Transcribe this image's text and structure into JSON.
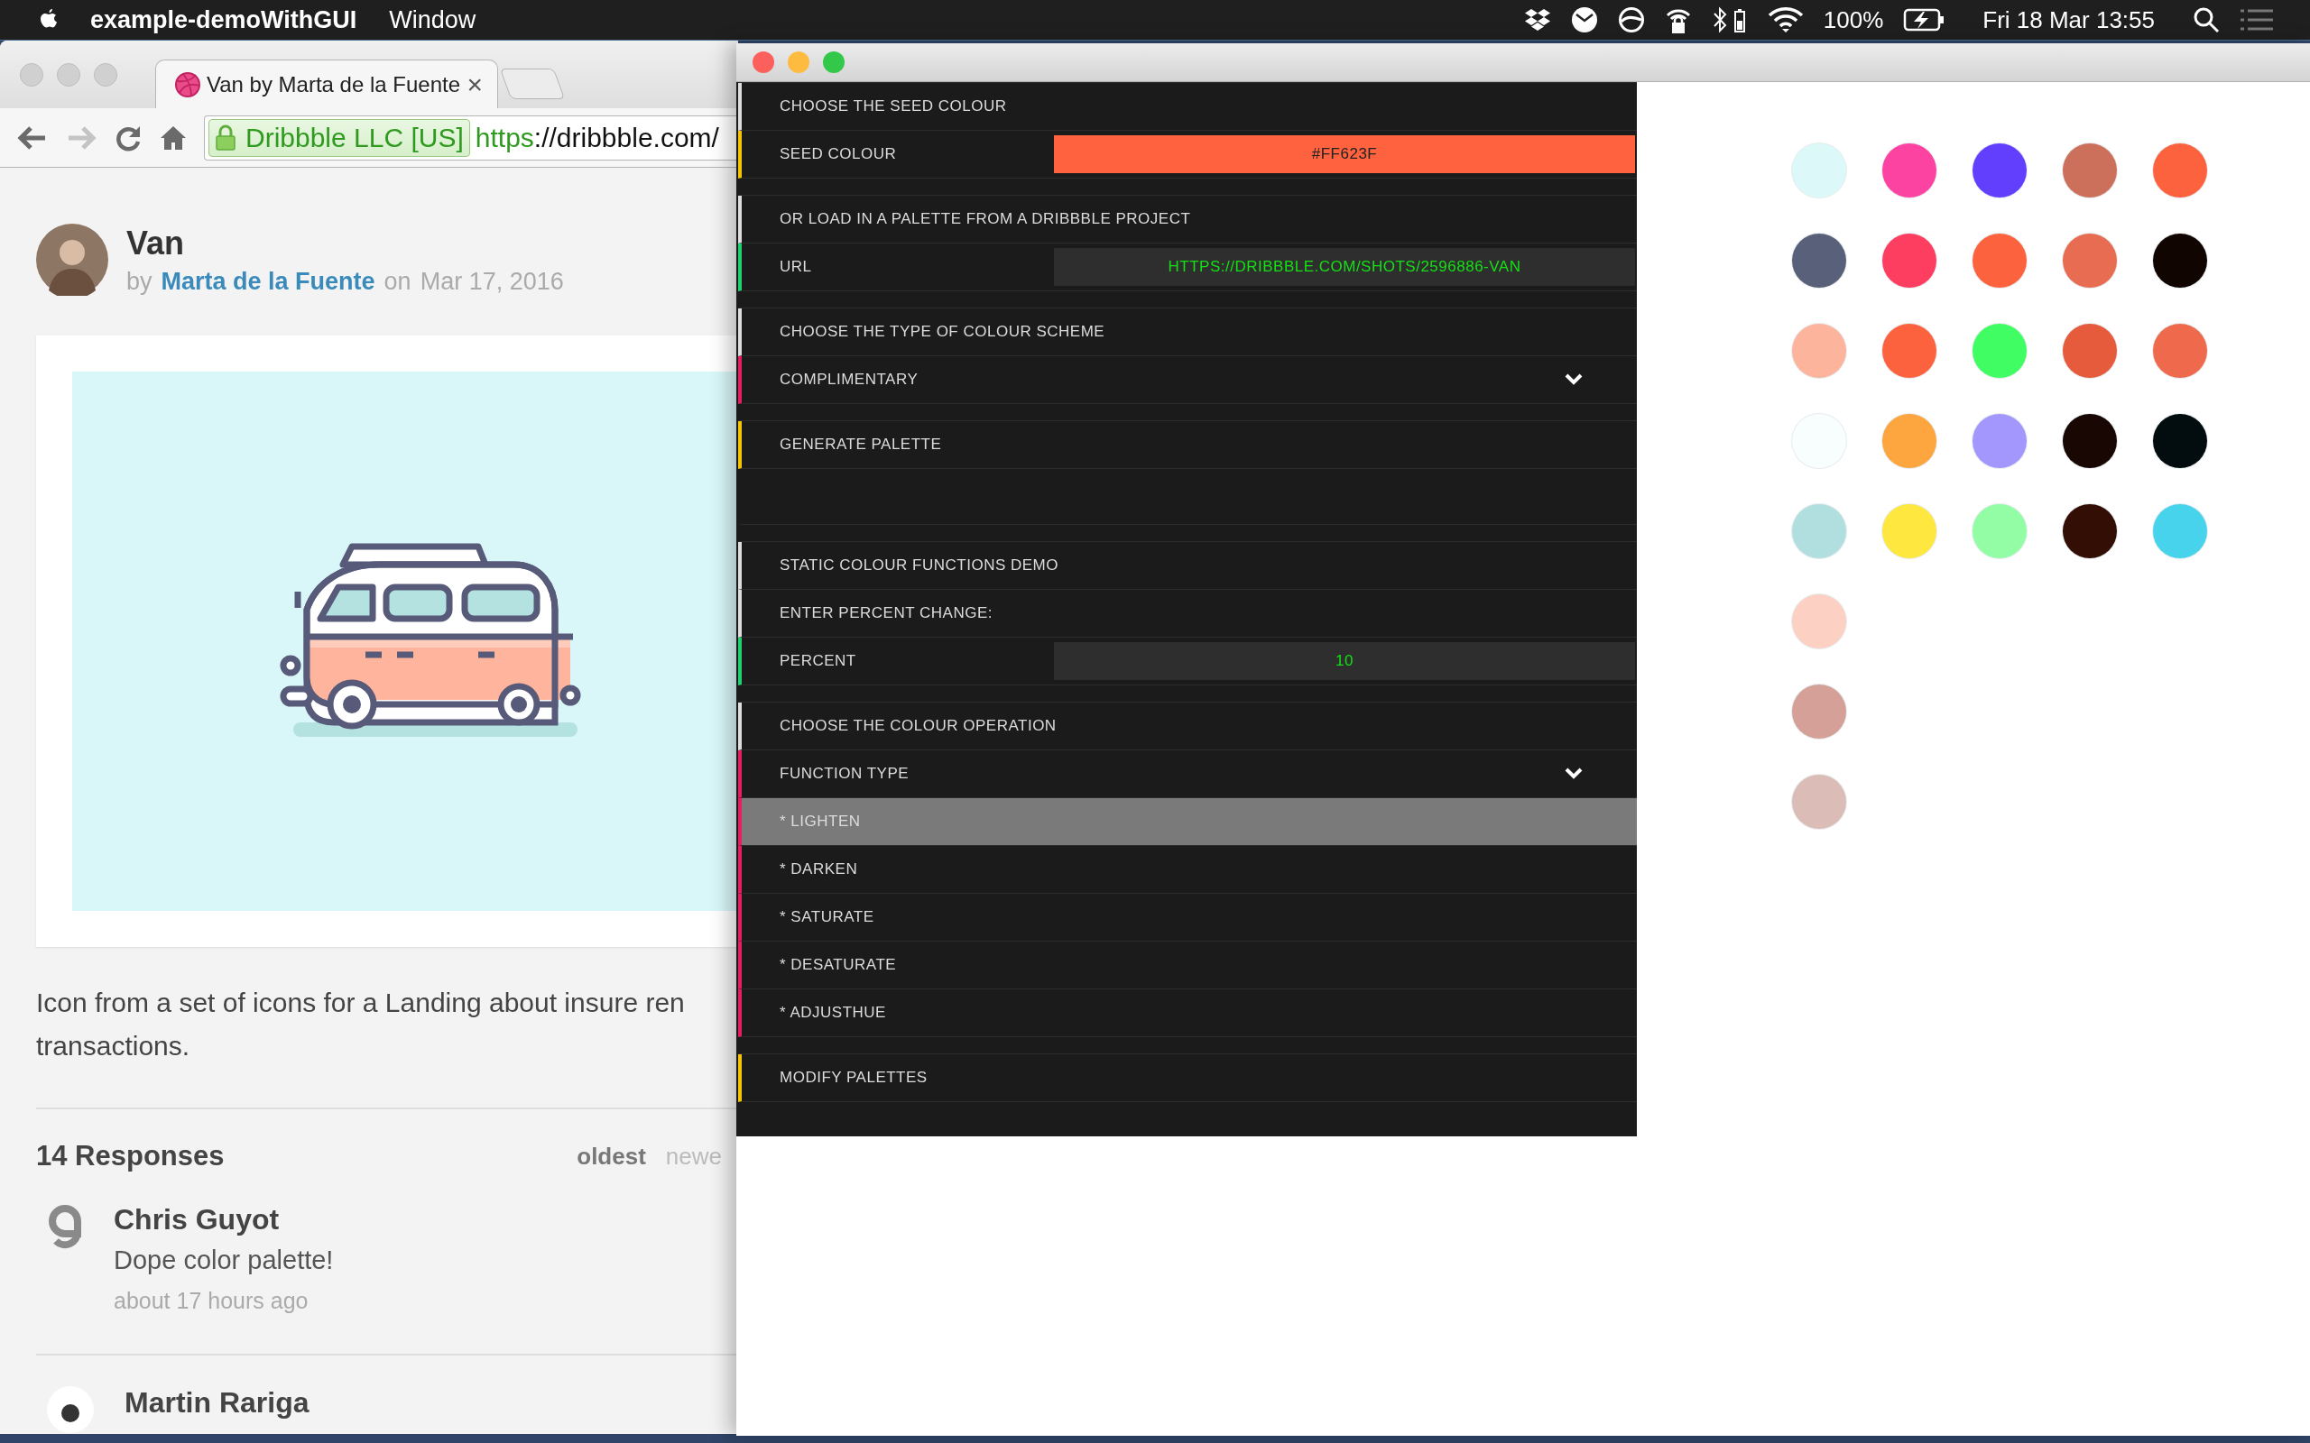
{
  "menu_bar": {
    "app_name": "example-demoWithGUI",
    "menus": [
      "Window"
    ],
    "battery": "100%",
    "clock": "Fri 18 Mar  13:55"
  },
  "browser": {
    "tab": {
      "title": "Van by Marta de la Fuente",
      "close": "×",
      "selected": true
    },
    "address": {
      "ev_label": "Dribbble LLC [US]",
      "scheme": "https",
      "rest": "://dribbble.com/"
    },
    "shot": {
      "title": "Van",
      "by": "by",
      "author": "Marta de la Fuente",
      "on": "on",
      "date": "Mar 17, 2016"
    },
    "description": [
      "Icon from a set of icons for a Landing about insure ren",
      "transactions."
    ],
    "responses": {
      "title": "14 Responses",
      "sort": [
        {
          "label": "oldest",
          "selected": true
        },
        {
          "label": "newe",
          "selected": false
        }
      ]
    },
    "comments": [
      {
        "author": "Chris Guyot",
        "text": "Dope color palette!",
        "time": "about 17 hours ago"
      },
      {
        "author": "Martin Rariga"
      }
    ]
  },
  "gui": {
    "groups": [
      {
        "rows": [
          {
            "kind": "title",
            "label": "CHOOSE THE SEED COLOUR"
          },
          {
            "kind": "color",
            "label": "SEED COLOUR",
            "value": "#FF623F"
          }
        ]
      },
      {
        "rows": [
          {
            "kind": "title",
            "label": "OR LOAD IN A PALETTE FROM A DRIBBBLE PROJECT"
          },
          {
            "kind": "text",
            "label": "URL",
            "value": "HTTPS://DRIBBBLE.COM/SHOTS/2596886-VAN"
          }
        ]
      },
      {
        "rows": [
          {
            "kind": "title",
            "label": "CHOOSE THE TYPE OF COLOUR SCHEME"
          },
          {
            "kind": "dropdown",
            "label": "COMPLIMENTARY"
          }
        ]
      },
      {
        "rows": [
          {
            "kind": "button",
            "label": "GENERATE PALETTE"
          },
          {
            "kind": "empty"
          }
        ]
      },
      {
        "rows": [
          {
            "kind": "title",
            "label": "STATIC COLOUR FUNCTIONS DEMO"
          },
          {
            "kind": "title",
            "label": "ENTER PERCENT CHANGE:"
          },
          {
            "kind": "number",
            "label": "PERCENT",
            "value": "10"
          }
        ]
      },
      {
        "rows": [
          {
            "kind": "title",
            "label": "CHOOSE THE COLOUR OPERATION"
          },
          {
            "kind": "dropdown",
            "label": "FUNCTION TYPE",
            "options": [
              {
                "label": "* LIGHTEN",
                "selected": true
              },
              {
                "label": "* DARKEN",
                "selected": false
              },
              {
                "label": "* SATURATE",
                "selected": false
              },
              {
                "label": "* DESATURATE",
                "selected": false
              },
              {
                "label": "* ADJUSTHUE",
                "selected": false
              }
            ]
          }
        ]
      },
      {
        "rows": [
          {
            "kind": "button",
            "label": "MODIFY PALETTES"
          }
        ]
      }
    ]
  },
  "palette": {
    "columns": [
      {
        "swatches": [
          {
            "color": "#dcf8f9"
          },
          {
            "color": "#596079"
          },
          {
            "color": "#fdb49d"
          },
          {
            "color": "#f8fdfe"
          },
          {
            "color": "#b1dfe0"
          },
          {
            "color": "#fcd0c3"
          },
          {
            "color": "#d4a098"
          },
          {
            "color": "#dcbcb6"
          }
        ]
      },
      {
        "swatches": [
          {
            "color": "#fd43a1"
          },
          {
            "color": "#fd3e61"
          },
          {
            "color": "#fd623f"
          },
          {
            "color": "#fda53f"
          },
          {
            "color": "#fee73f"
          }
        ]
      },
      {
        "swatches": [
          {
            "color": "#623ffd"
          },
          {
            "color": "#fd623f"
          },
          {
            "color": "#3ffd62"
          },
          {
            "color": "#a397fd"
          },
          {
            "color": "#93fda6"
          }
        ]
      },
      {
        "swatches": [
          {
            "color": "#cd705b"
          },
          {
            "color": "#e86c52"
          },
          {
            "color": "#e55b3b"
          },
          {
            "color": "#190703"
          },
          {
            "color": "#330e05"
          }
        ]
      },
      {
        "swatches": [
          {
            "color": "#fd623f"
          },
          {
            "color": "#110502"
          },
          {
            "color": "#ef6a4c"
          },
          {
            "color": "#030c0f"
          },
          {
            "color": "#48d3ed"
          }
        ]
      }
    ]
  }
}
